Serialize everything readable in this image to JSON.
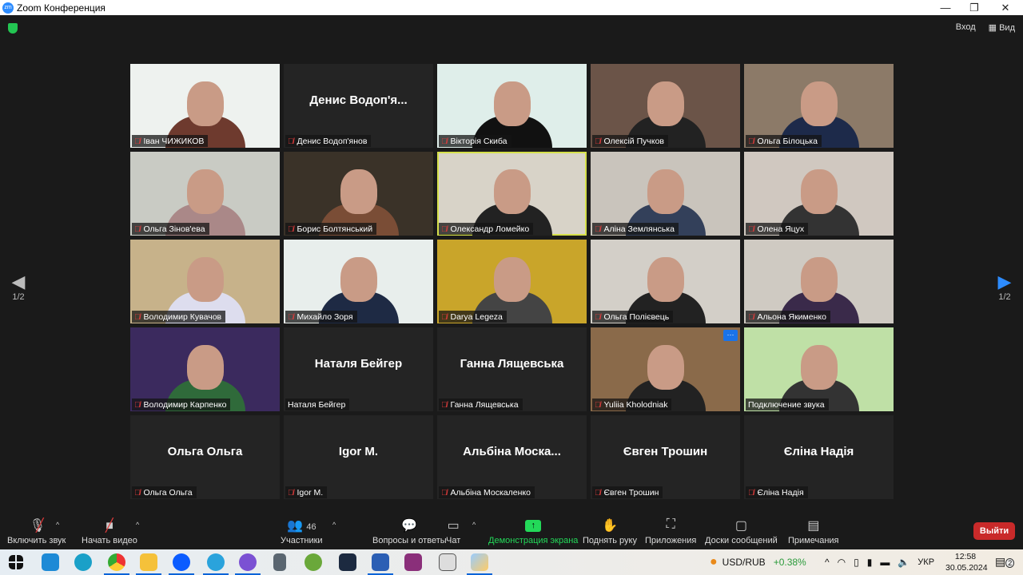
{
  "window": {
    "title": "Zoom Конференция",
    "minimize": "—",
    "maximize": "❐",
    "close": "✕"
  },
  "header": {
    "exit_fullscreen": "Вход",
    "view": "Вид"
  },
  "pagination": {
    "left": "1/2",
    "right": "1/2"
  },
  "participants": [
    {
      "name": "Іван ЧИЖИКОВ",
      "video": true,
      "bg": "#eef2ef",
      "shirt": "#6e3a2e"
    },
    {
      "name": "Денис Водоп'янов",
      "display": "Денис Водоп'я...",
      "video": false
    },
    {
      "name": "Вікторія Скиба",
      "video": true,
      "bg": "#dfeeea",
      "shirt": "#111"
    },
    {
      "name": "Олексій Пучков",
      "video": true,
      "bg": "#6b5448",
      "shirt": "#222"
    },
    {
      "name": "Ольга Білоцька",
      "video": true,
      "bg": "#8c7a68",
      "shirt": "#1d2a4a"
    },
    {
      "name": "Ольга Зінов'ева",
      "video": true,
      "bg": "#c9cbc4",
      "shirt": "#a88"
    },
    {
      "name": "Борис Болтянський",
      "video": true,
      "bg": "#3a3228",
      "shirt": "#7a4d36"
    },
    {
      "name": "Олександр Ломейко",
      "video": true,
      "bg": "#d8d3c8",
      "shirt": "#222",
      "active": true
    },
    {
      "name": "Аліна Землянська",
      "video": true,
      "bg": "#c9c4bc",
      "shirt": "#33405a"
    },
    {
      "name": "Олена Яцух",
      "video": true,
      "bg": "#d0c8c0",
      "shirt": "#333"
    },
    {
      "name": "Володимир Кувачов",
      "video": true,
      "bg": "#c7b28a",
      "shirt": "#dde"
    },
    {
      "name": "Михайло Зоря",
      "video": true,
      "bg": "#e8eeec",
      "shirt": "#1e2a44"
    },
    {
      "name": "Darya Legeza",
      "video": true,
      "bg": "#c9a52a",
      "shirt": "#444"
    },
    {
      "name": "Ольга Полієвець",
      "video": true,
      "bg": "#d3cfc8",
      "shirt": "#222"
    },
    {
      "name": "Альона Якименко",
      "video": true,
      "bg": "#cfcac2",
      "shirt": "#3a2a4a"
    },
    {
      "name": "Володимир Карпенко",
      "video": true,
      "bg": "#3b2a5e",
      "shirt": "#2f6a3a"
    },
    {
      "name": "Наталя Бейгер",
      "video": false,
      "muted": false
    },
    {
      "name": "Ганна Лящевська",
      "video": false
    },
    {
      "name": "Yuliia Kholodniak",
      "video": true,
      "bg": "#8a6a4a",
      "shirt": "#222",
      "more": "···"
    },
    {
      "name": "Подключение звука",
      "video": true,
      "bg": "#bfe0a6",
      "shirt": "#333",
      "muted": false
    },
    {
      "name": "Ольга Ольга",
      "video": false
    },
    {
      "name": "Igor M.",
      "video": false
    },
    {
      "name": "Альбіна Москаленко",
      "display": "Альбіна Моска...",
      "video": false
    },
    {
      "name": "Євген Трошин",
      "video": false
    },
    {
      "name": "Єліна Надія",
      "video": false
    }
  ],
  "toolbar": {
    "unmute": "Включить звук",
    "start_video": "Начать видео",
    "participants": "Участники",
    "participants_count": "46",
    "qa": "Вопросы и ответы",
    "chat": "Чат",
    "share": "Демонстрация экрана",
    "raise_hand": "Поднять руку",
    "apps": "Приложения",
    "whiteboards": "Доски сообщений",
    "notes": "Примечания",
    "leave": "Выйти"
  },
  "taskbar": {
    "ticker": "USD/RUB",
    "ticker_change": "+0.38%",
    "lang": "УКР",
    "time": "12:58",
    "date": "30.05.2024",
    "notifications": "2"
  }
}
